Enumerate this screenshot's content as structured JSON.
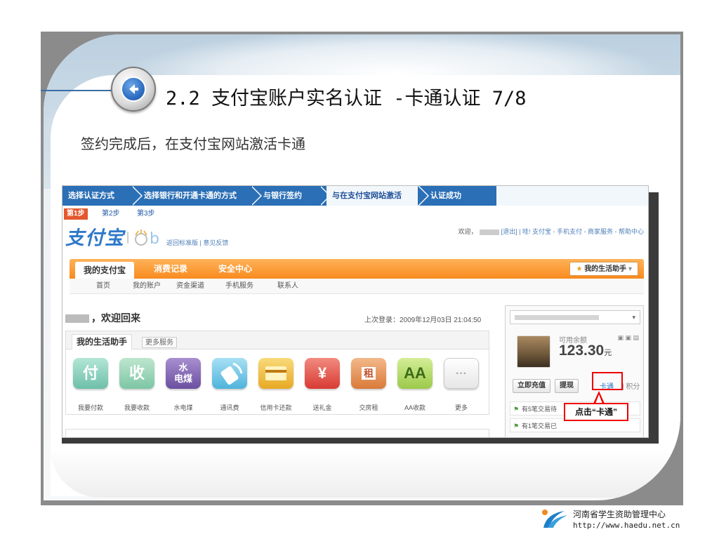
{
  "slide": {
    "title": "2.2  支付宝账户实名认证 -卡通认证 7/8",
    "subtitle": "签约完成后，在支付宝网站激活卡通",
    "footer_org": "河南省学生资助管理中心",
    "footer_url": "http://www.haedu.net.cn"
  },
  "steps": [
    "选择认证方式",
    "选择银行和开通卡通的方式",
    "与银行签约",
    "与在支付宝网站激活",
    "认证成功"
  ],
  "substeps": [
    "第1步",
    "第2步",
    "第3步"
  ],
  "site": {
    "logo": "支付宝",
    "top_links": "返回标准版 | 意见反馈",
    "welcome_prefix": "欢迎，",
    "welcome_logout": "[退出]",
    "welcome_links": "| 哇! 支付宝 - 手机支付 - 商家服务 - 帮助中心"
  },
  "nav": {
    "tabs": [
      "我的支付宝",
      "消费记录",
      "安全中心"
    ],
    "life_helper": "我的生活助手",
    "subnav": [
      "首页",
      "我的账户",
      "资金渠道",
      "手机服务",
      "联系人"
    ]
  },
  "main": {
    "greeting": "，欢迎回来",
    "last_login": "上次登录：2009年12月03日 21:04:50",
    "helper_tab": "我的生活助手",
    "helper_more": "更多服务",
    "apps": [
      {
        "icon": "付",
        "label": "我要付款",
        "color": "#7fc6b6"
      },
      {
        "icon": "收",
        "label": "我要收款",
        "color": "#8ccbb1"
      },
      {
        "icon": "水电煤",
        "label": "水电煤",
        "color": "#8b6fb8"
      },
      {
        "icon": "wifi",
        "label": "通讯费",
        "color": "#6ec7e8"
      },
      {
        "icon": "card",
        "label": "信用卡还款",
        "color": "#f0b93a"
      },
      {
        "icon": "¥",
        "label": "送礼金",
        "color": "#e5574e"
      },
      {
        "icon": "租",
        "label": "交房租",
        "color": "#e08a4a"
      },
      {
        "icon": "AA",
        "label": "AA收款",
        "color": "#a5cf5e"
      },
      {
        "icon": "···",
        "label": "更多",
        "color": "#f2f2f2"
      }
    ]
  },
  "account": {
    "available_label": "可用余额",
    "balance": "123.30",
    "currency": "元",
    "recharge": "立即充值",
    "withdraw": "提现",
    "cartoon": "卡通",
    "points": "积分",
    "notice1": "有5笔交易待",
    "notice2": "有1笔交易已"
  },
  "callout": "点击“卡通”"
}
